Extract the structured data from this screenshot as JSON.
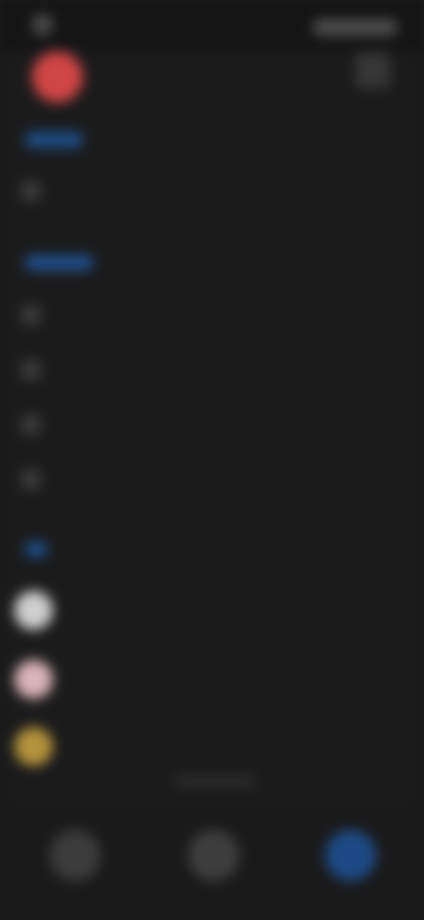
{
  "screen": {
    "status_bar": {},
    "header": {
      "title": "",
      "logo_color": "#d04545",
      "action_icon": "menu-icon"
    },
    "section_1": {
      "accent": "#1e4d88",
      "items": [
        {
          "label": "",
          "icon": "list-icon"
        }
      ]
    },
    "section_2": {
      "accent": "#1e4d88",
      "items": [
        {
          "label": "",
          "icon": "settings-icon"
        },
        {
          "label": "",
          "icon": "grid-icon"
        },
        {
          "label": "",
          "icon": "tools-icon"
        },
        {
          "label": "",
          "icon": "help-icon"
        }
      ]
    },
    "section_3": {
      "accent": "#1e4d88",
      "apps": [
        {
          "label": "",
          "color": "#cfcfcf"
        },
        {
          "label": "",
          "color": "#d9b4b8"
        },
        {
          "label": "",
          "color": "#b4933d"
        }
      ]
    },
    "footer": {
      "text": ""
    },
    "bottom_nav": [
      {
        "icon": "home-icon",
        "active": false
      },
      {
        "icon": "globe-icon",
        "active": false
      },
      {
        "icon": "profile-icon",
        "active": true
      }
    ]
  }
}
